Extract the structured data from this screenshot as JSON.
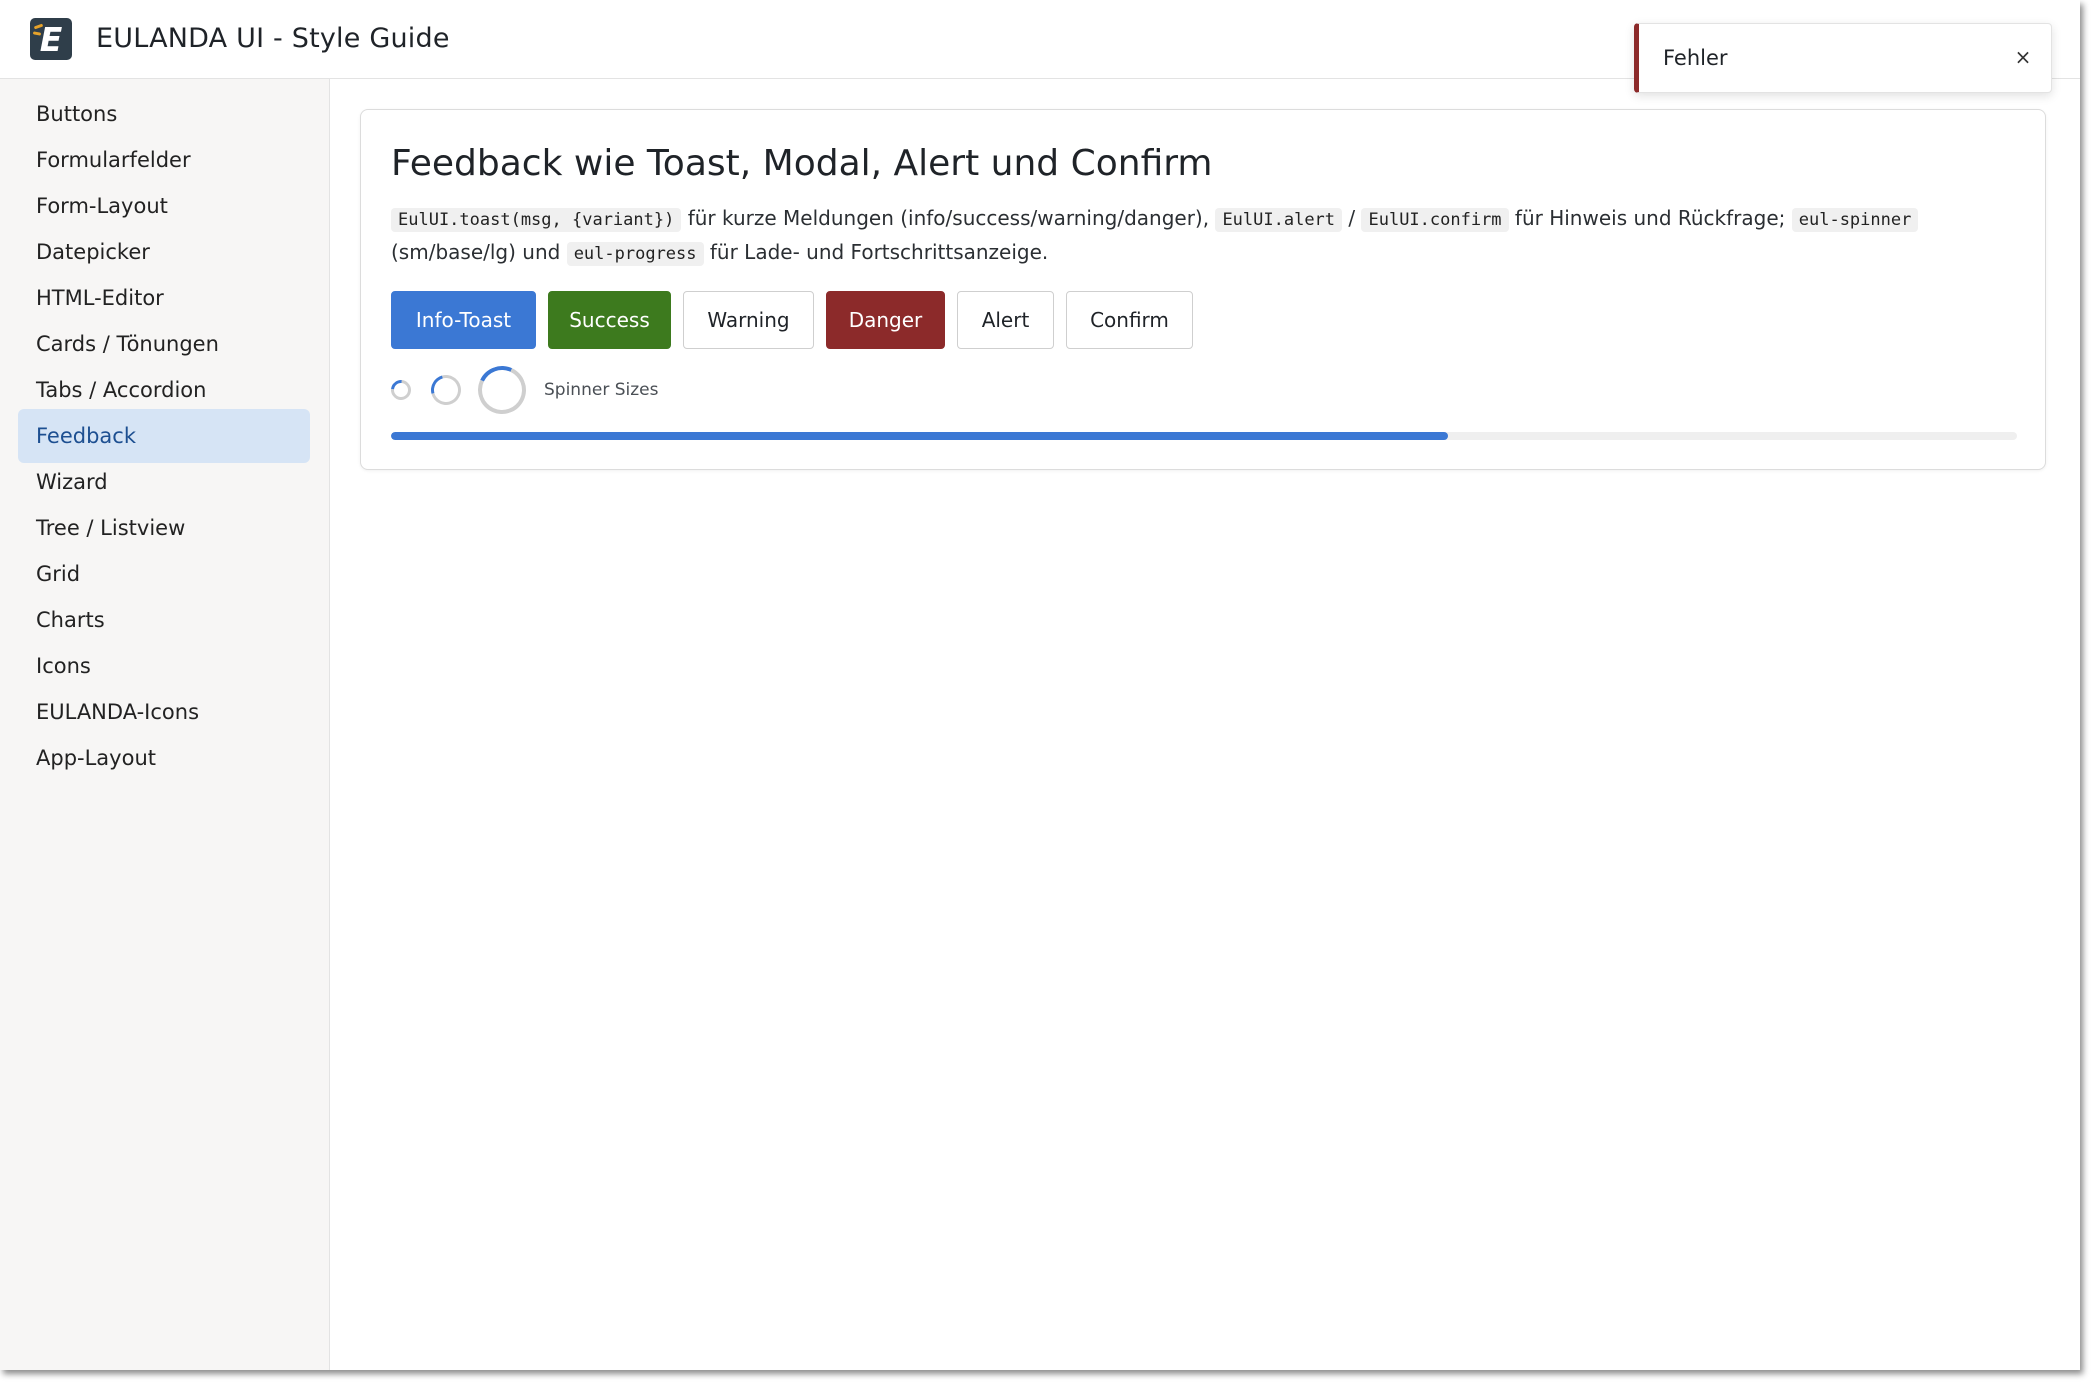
{
  "header": {
    "logo_icon": "eulanda-logo-icon",
    "logo_letter": "E",
    "title": "EULANDA UI - Style Guide"
  },
  "sidebar": {
    "active_index": 7,
    "items": [
      {
        "label": "Buttons"
      },
      {
        "label": "Formularfelder"
      },
      {
        "label": "Form-Layout"
      },
      {
        "label": "Datepicker"
      },
      {
        "label": "HTML-Editor"
      },
      {
        "label": "Cards / Tönungen"
      },
      {
        "label": "Tabs / Accordion"
      },
      {
        "label": "Feedback"
      },
      {
        "label": "Wizard"
      },
      {
        "label": "Tree / Listview"
      },
      {
        "label": "Grid"
      },
      {
        "label": "Charts"
      },
      {
        "label": "Icons"
      },
      {
        "label": "EULANDA-Icons"
      },
      {
        "label": "App-Layout"
      }
    ]
  },
  "card": {
    "title": "Feedback wie Toast, Modal, Alert und Confirm",
    "description": {
      "code_toast": "EulUI.toast(msg, {variant})",
      "text_1": " für kurze Meldungen (info/success/warning/danger), ",
      "code_alert": "EulUI.alert",
      "sep": " / ",
      "code_confirm": "EulUI.confirm",
      "text_2": " für Hinweis und Rückfrage; ",
      "code_spinner": "eul-spinner",
      "text_3": " (sm/base/lg) und ",
      "code_progress": "eul-progress",
      "text_4": " für Lade- und Fortschrittsanzeige."
    },
    "buttons": {
      "info_toast": "Info-Toast",
      "success": "Success",
      "warning": "Warning",
      "danger": "Danger",
      "alert": "Alert",
      "confirm": "Confirm"
    },
    "spinner_label": "Spinner Sizes",
    "progress_fraction": 0.65
  },
  "toast": {
    "message": "Fehler",
    "close_glyph": "×",
    "variant": "danger"
  },
  "colors": {
    "primary": "#3b78d4",
    "success": "#3d7a1e",
    "danger": "#8c2a2a",
    "active_nav_bg": "#d6e4f5",
    "active_nav_text": "#1d4f91"
  }
}
